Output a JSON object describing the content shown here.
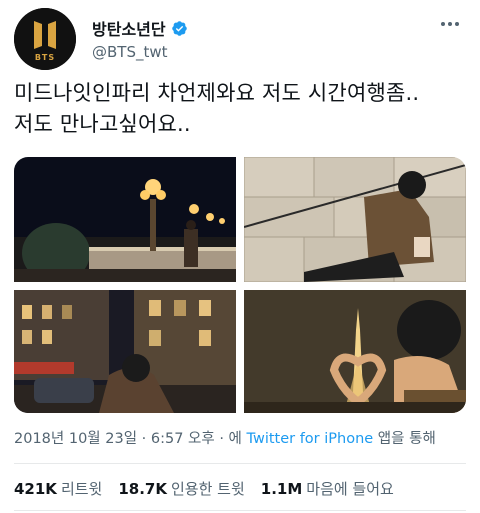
{
  "author": {
    "display_name": "방탄소년단",
    "handle": "@BTS_twt",
    "logo_text": "BTS",
    "avatar_bg": "#111111",
    "verified_color": "#1d9bf0"
  },
  "tweet": {
    "text_line1": "미드나잇인파리 차언제와요 저도 시간여행좀..",
    "text_line2": "저도 만나고싶어요..",
    "time": "2018년 10월 23일 · 6:57 오후 · ",
    "via_prefix": "에 ",
    "source": "Twitter for iPhone",
    "via_suffix": " 앱을 통해"
  },
  "stats": {
    "retweets_count": "421K",
    "retweets_label": "리트윗",
    "quotes_count": "18.7K",
    "quotes_label": "인용한 트윗",
    "likes_count": "1.1M",
    "likes_label": "마음에 들어요"
  },
  "colors": {
    "link": "#1d9bf0",
    "secondary_text": "#536471",
    "primary_text": "#0f1419",
    "divider": "#e7e9ea"
  }
}
